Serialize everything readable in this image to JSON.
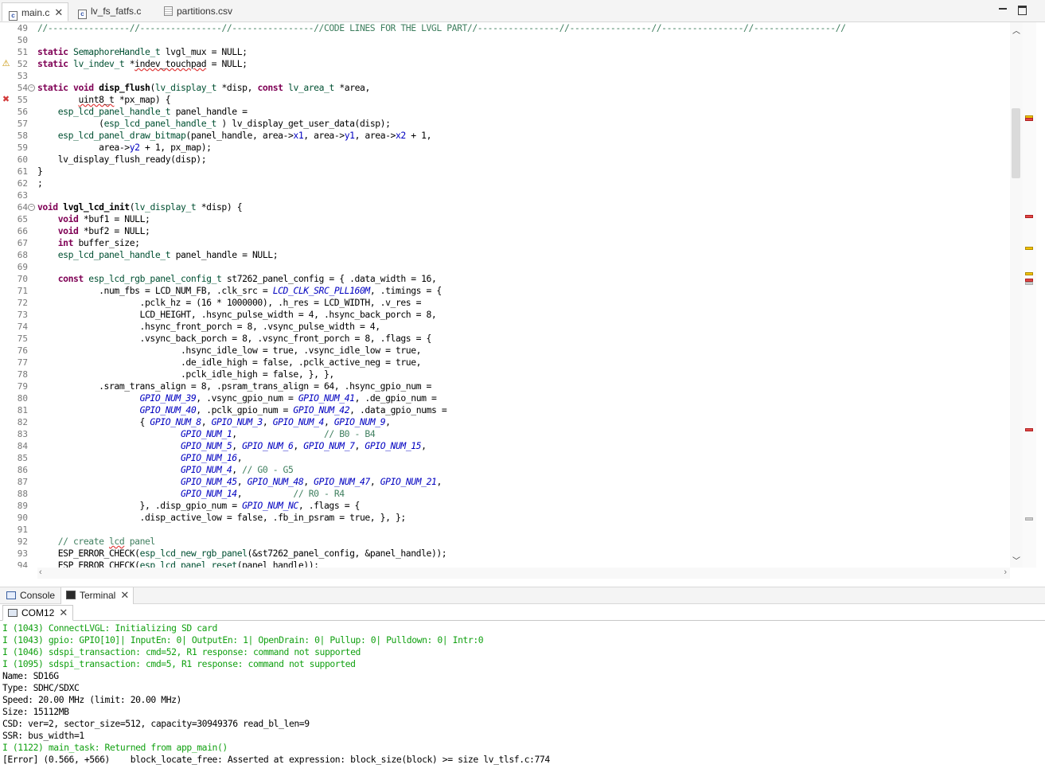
{
  "editor_tabs": [
    {
      "label": "main.c",
      "icon": "c-file-icon",
      "active": true
    },
    {
      "label": "lv_fs_fatfs.c",
      "icon": "c-file-icon",
      "active": false
    },
    {
      "label": "partitions.csv",
      "icon": "csv-file-icon",
      "active": false
    }
  ],
  "window_controls": {
    "minimize": "▭",
    "maximize": "□"
  },
  "code_lines": [
    {
      "n": "49",
      "parts": [
        [
          "cm",
          "//----------------//----------------//----------------//CODE LINES FOR THE LVGL PART//----------------//----------------//----------------//----------------//"
        ]
      ]
    },
    {
      "n": "50",
      "parts": []
    },
    {
      "n": "51",
      "parts": [
        [
          "k",
          "static"
        ],
        [
          "",
          " "
        ],
        [
          "t",
          "SemaphoreHandle_t"
        ],
        [
          "",
          " lvgl_mux = NULL;"
        ]
      ]
    },
    {
      "n": "52",
      "marker": "warning",
      "parts": [
        [
          "k",
          "static"
        ],
        [
          "",
          " "
        ],
        [
          "t",
          "lv_indev_t"
        ],
        [
          "",
          " *"
        ],
        [
          "sq",
          "indev_touchpad"
        ],
        [
          "",
          " = NULL;"
        ]
      ]
    },
    {
      "n": "53",
      "parts": []
    },
    {
      "n": "54",
      "fold": true,
      "parts": [
        [
          "k",
          "static"
        ],
        [
          "",
          " "
        ],
        [
          "k",
          "void"
        ],
        [
          "",
          " "
        ],
        [
          "f",
          "disp_flush"
        ],
        [
          "",
          "("
        ],
        [
          "t",
          "lv_display_t"
        ],
        [
          "",
          " *disp, "
        ],
        [
          "k",
          "const"
        ],
        [
          "",
          " "
        ],
        [
          "t",
          "lv_area_t"
        ],
        [
          "",
          " *area,"
        ]
      ]
    },
    {
      "n": "55",
      "marker": "error",
      "parts": [
        [
          "",
          "        "
        ],
        [
          "sq",
          "uint8_t"
        ],
        [
          "",
          " *px_map) {"
        ]
      ]
    },
    {
      "n": "56",
      "parts": [
        [
          "",
          "    "
        ],
        [
          "t",
          "esp_lcd_panel_handle_t"
        ],
        [
          "",
          " panel_handle ="
        ]
      ]
    },
    {
      "n": "57",
      "parts": [
        [
          "",
          "            ("
        ],
        [
          "t",
          "esp_lcd_panel_handle_t"
        ],
        [
          "",
          " ) lv_display_get_user_data(disp);"
        ]
      ]
    },
    {
      "n": "58",
      "parts": [
        [
          "",
          "    "
        ],
        [
          "t",
          "esp_lcd_panel_draw_bitmap"
        ],
        [
          "",
          "(panel_handle, area->"
        ],
        [
          "v",
          "x1"
        ],
        [
          "",
          ", area->"
        ],
        [
          "v",
          "y1"
        ],
        [
          "",
          ", area->"
        ],
        [
          "v",
          "x2"
        ],
        [
          "",
          " + 1,"
        ]
      ]
    },
    {
      "n": "59",
      "parts": [
        [
          "",
          "            area->"
        ],
        [
          "v",
          "y2"
        ],
        [
          "",
          " + 1, px_map);"
        ]
      ]
    },
    {
      "n": "60",
      "parts": [
        [
          "",
          "    lv_display_flush_ready(disp);"
        ]
      ]
    },
    {
      "n": "61",
      "parts": [
        [
          "",
          "}"
        ]
      ]
    },
    {
      "n": "62",
      "parts": [
        [
          "",
          ";"
        ]
      ]
    },
    {
      "n": "63",
      "parts": []
    },
    {
      "n": "64",
      "fold": true,
      "parts": [
        [
          "k",
          "void"
        ],
        [
          "",
          " "
        ],
        [
          "f",
          "lvgl_lcd_init"
        ],
        [
          "",
          "("
        ],
        [
          "t",
          "lv_display_t"
        ],
        [
          "",
          " *disp) {"
        ]
      ]
    },
    {
      "n": "65",
      "parts": [
        [
          "",
          "    "
        ],
        [
          "k",
          "void"
        ],
        [
          "",
          " *buf1 = NULL;"
        ]
      ]
    },
    {
      "n": "66",
      "parts": [
        [
          "",
          "    "
        ],
        [
          "k",
          "void"
        ],
        [
          "",
          " *buf2 = NULL;"
        ]
      ]
    },
    {
      "n": "67",
      "parts": [
        [
          "",
          "    "
        ],
        [
          "k",
          "int"
        ],
        [
          "",
          " buffer_size;"
        ]
      ]
    },
    {
      "n": "68",
      "parts": [
        [
          "",
          "    "
        ],
        [
          "t",
          "esp_lcd_panel_handle_t"
        ],
        [
          "",
          " panel_handle = NULL;"
        ]
      ]
    },
    {
      "n": "69",
      "parts": []
    },
    {
      "n": "70",
      "parts": [
        [
          "",
          "    "
        ],
        [
          "k",
          "const"
        ],
        [
          "",
          " "
        ],
        [
          "t",
          "esp_lcd_rgb_panel_config_t"
        ],
        [
          "",
          " st7262_panel_config = { .data_width = 16,"
        ]
      ]
    },
    {
      "n": "71",
      "parts": [
        [
          "",
          "            .num_fbs = LCD_NUM_FB, .clk_src = "
        ],
        [
          "m",
          "LCD_CLK_SRC_PLL160M"
        ],
        [
          "",
          ", .timings = {"
        ]
      ]
    },
    {
      "n": "72",
      "parts": [
        [
          "",
          "                    .pclk_hz = (16 * 1000000), .h_res = LCD_WIDTH, .v_res ="
        ]
      ]
    },
    {
      "n": "73",
      "parts": [
        [
          "",
          "                    LCD_HEIGHT, .hsync_pulse_width = 4, .hsync_back_porch = 8,"
        ]
      ]
    },
    {
      "n": "74",
      "parts": [
        [
          "",
          "                    .hsync_front_porch = 8, .vsync_pulse_width = 4,"
        ]
      ]
    },
    {
      "n": "75",
      "parts": [
        [
          "",
          "                    .vsync_back_porch = 8, .vsync_front_porch = 8, .flags = {"
        ]
      ]
    },
    {
      "n": "76",
      "parts": [
        [
          "",
          "                            .hsync_idle_low = true, .vsync_idle_low = true,"
        ]
      ]
    },
    {
      "n": "77",
      "parts": [
        [
          "",
          "                            .de_idle_high = false, .pclk_active_neg = true,"
        ]
      ]
    },
    {
      "n": "78",
      "parts": [
        [
          "",
          "                            .pclk_idle_high = false, }, },"
        ]
      ]
    },
    {
      "n": "79",
      "parts": [
        [
          "",
          "            .sram_trans_align = 8, .psram_trans_align = 64, .hsync_gpio_num ="
        ]
      ]
    },
    {
      "n": "80",
      "parts": [
        [
          "",
          "                    "
        ],
        [
          "m",
          "GPIO_NUM_39"
        ],
        [
          "",
          ", .vsync_gpio_num = "
        ],
        [
          "m",
          "GPIO_NUM_41"
        ],
        [
          "",
          ", .de_gpio_num ="
        ]
      ]
    },
    {
      "n": "81",
      "parts": [
        [
          "",
          "                    "
        ],
        [
          "m",
          "GPIO_NUM_40"
        ],
        [
          "",
          ", .pclk_gpio_num = "
        ],
        [
          "m",
          "GPIO_NUM_42"
        ],
        [
          "",
          ", .data_gpio_nums ="
        ]
      ]
    },
    {
      "n": "82",
      "parts": [
        [
          "",
          "                    { "
        ],
        [
          "m",
          "GPIO_NUM_8"
        ],
        [
          "",
          ", "
        ],
        [
          "m",
          "GPIO_NUM_3"
        ],
        [
          "",
          ", "
        ],
        [
          "m",
          "GPIO_NUM_4"
        ],
        [
          "",
          ", "
        ],
        [
          "m",
          "GPIO_NUM_9"
        ],
        [
          "",
          ","
        ]
      ]
    },
    {
      "n": "83",
      "parts": [
        [
          "",
          "                            "
        ],
        [
          "m",
          "GPIO_NUM_1"
        ],
        [
          "",
          ",                 "
        ],
        [
          "cm",
          "// B0 - B4"
        ]
      ]
    },
    {
      "n": "84",
      "parts": [
        [
          "",
          "                            "
        ],
        [
          "m",
          "GPIO_NUM_5"
        ],
        [
          "",
          ", "
        ],
        [
          "m",
          "GPIO_NUM_6"
        ],
        [
          "",
          ", "
        ],
        [
          "m",
          "GPIO_NUM_7"
        ],
        [
          "",
          ", "
        ],
        [
          "m",
          "GPIO_NUM_15"
        ],
        [
          "",
          ","
        ]
      ]
    },
    {
      "n": "85",
      "parts": [
        [
          "",
          "                            "
        ],
        [
          "m",
          "GPIO_NUM_16"
        ],
        [
          "",
          ","
        ]
      ]
    },
    {
      "n": "86",
      "parts": [
        [
          "",
          "                            "
        ],
        [
          "m",
          "GPIO_NUM_4"
        ],
        [
          "",
          ", "
        ],
        [
          "cm",
          "// G0 - G5"
        ]
      ]
    },
    {
      "n": "87",
      "parts": [
        [
          "",
          "                            "
        ],
        [
          "m",
          "GPIO_NUM_45"
        ],
        [
          "",
          ", "
        ],
        [
          "m",
          "GPIO_NUM_48"
        ],
        [
          "",
          ", "
        ],
        [
          "m",
          "GPIO_NUM_47"
        ],
        [
          "",
          ", "
        ],
        [
          "m",
          "GPIO_NUM_21"
        ],
        [
          "",
          ","
        ]
      ]
    },
    {
      "n": "88",
      "parts": [
        [
          "",
          "                            "
        ],
        [
          "m",
          "GPIO_NUM_14"
        ],
        [
          "",
          ",          "
        ],
        [
          "cm",
          "// R0 - R4"
        ]
      ]
    },
    {
      "n": "89",
      "parts": [
        [
          "",
          "                    }, .disp_gpio_num = "
        ],
        [
          "m",
          "GPIO_NUM_NC"
        ],
        [
          "",
          ", .flags = {"
        ]
      ]
    },
    {
      "n": "90",
      "parts": [
        [
          "",
          "                    .disp_active_low = false, .fb_in_psram = true, }, };"
        ]
      ]
    },
    {
      "n": "91",
      "parts": []
    },
    {
      "n": "92",
      "parts": [
        [
          "cm",
          "    // create "
        ],
        [
          "cm sq",
          "lcd"
        ],
        [
          "cm",
          " panel"
        ]
      ]
    },
    {
      "n": "93",
      "parts": [
        [
          "",
          "    ESP_ERROR_CHECK("
        ],
        [
          "t",
          "esp_lcd_new_rgb_panel"
        ],
        [
          "",
          "(&st7262_panel_config, &panel_handle));"
        ]
      ]
    },
    {
      "n": "94",
      "parts": [
        [
          "",
          "    ESP_ERROR_CHECK("
        ],
        [
          "t",
          "esp_lcd_panel_reset"
        ],
        [
          "",
          "(panel_handle));"
        ]
      ]
    }
  ],
  "panel_tabs": [
    {
      "label": "Console",
      "icon": "console-icon",
      "active": false
    },
    {
      "label": "Terminal",
      "icon": "terminal-icon",
      "active": true
    }
  ],
  "terminal_tab": {
    "label": "COM12",
    "icon": "serial-port-icon"
  },
  "terminal_lines": [
    {
      "text": "I (1043) ConnectLVGL: Initializing SD card",
      "color": "green"
    },
    {
      "text": "I (1043) gpio: GPIO[10]| InputEn: 0| OutputEn: 1| OpenDrain: 0| Pullup: 0| Pulldown: 0| Intr:0",
      "color": "green"
    },
    {
      "text": "I (1046) sdspi_transaction: cmd=52, R1 response: command not supported",
      "color": "green"
    },
    {
      "text": "I (1095) sdspi_transaction: cmd=5, R1 response: command not supported",
      "color": "green"
    },
    {
      "text": "Name: SD16G",
      "color": "black"
    },
    {
      "text": "Type: SDHC/SDXC",
      "color": "black"
    },
    {
      "text": "Speed: 20.00 MHz (limit: 20.00 MHz)",
      "color": "black"
    },
    {
      "text": "Size: 15112MB",
      "color": "black"
    },
    {
      "text": "CSD: ver=2, sector_size=512, capacity=30949376 read_bl_len=9",
      "color": "black"
    },
    {
      "text": "SSR: bus_width=1",
      "color": "black"
    },
    {
      "text": "I (1122) main_task: Returned from app_main()",
      "color": "green"
    },
    {
      "text": "[Error] (0.566, +566)    block_locate_free: Asserted at expression: block_size(block) >= size lv_tlsf.c:774",
      "color": "black"
    }
  ],
  "colors": {
    "green": "#12a112",
    "black": "#000000",
    "keyword": "#7f0055",
    "comment": "#3f7f5f",
    "macro": "#0000c0"
  },
  "overview_marks": [
    {
      "kind": "warning"
    },
    {
      "kind": "error"
    },
    {
      "kind": "error"
    },
    {
      "kind": "warning"
    },
    {
      "kind": "warning"
    },
    {
      "kind": "error"
    },
    {
      "kind": "info"
    },
    {
      "kind": "error"
    },
    {
      "kind": "info"
    }
  ]
}
